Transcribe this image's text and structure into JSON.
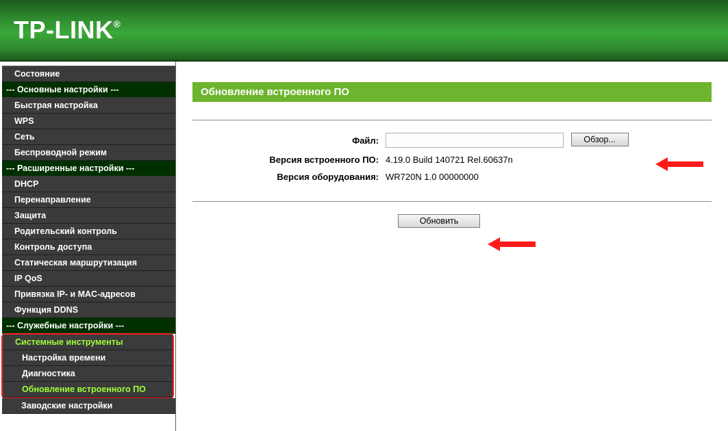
{
  "brand": "TP-LINK",
  "sidebar": {
    "top_item": "Состояние",
    "groups": [
      {
        "header": "--- Основные настройки ---",
        "items": [
          "Быстрая настройка",
          "WPS",
          "Сеть",
          "Беспроводной режим"
        ]
      },
      {
        "header": "--- Расширенные настройки ---",
        "items": [
          "DHCP",
          "Перенаправление",
          "Защита",
          "Родительский контроль",
          "Контроль доступа",
          "Статическая маршрутизация",
          "IP QoS",
          "Привязка IP- и MAC-адресов",
          "Функция DDNS"
        ]
      },
      {
        "header": "--- Служебные настройки ---",
        "items_hl": [
          "Системные инструменты",
          "Настройка времени",
          "Диагностика",
          "Обновление встроенного ПО"
        ],
        "items_after": [
          "Заводские настройки"
        ]
      }
    ]
  },
  "content": {
    "title": "Обновление встроенного ПО",
    "file_label": "Файл:",
    "browse_label": "Обзор...",
    "fw_label": "Версия встроенного ПО:",
    "fw_value": "4.19.0 Build 140721 Rel.60637n",
    "hw_label": "Версия оборудования:",
    "hw_value": "WR720N 1.0 00000000",
    "update_label": "Обновить"
  }
}
